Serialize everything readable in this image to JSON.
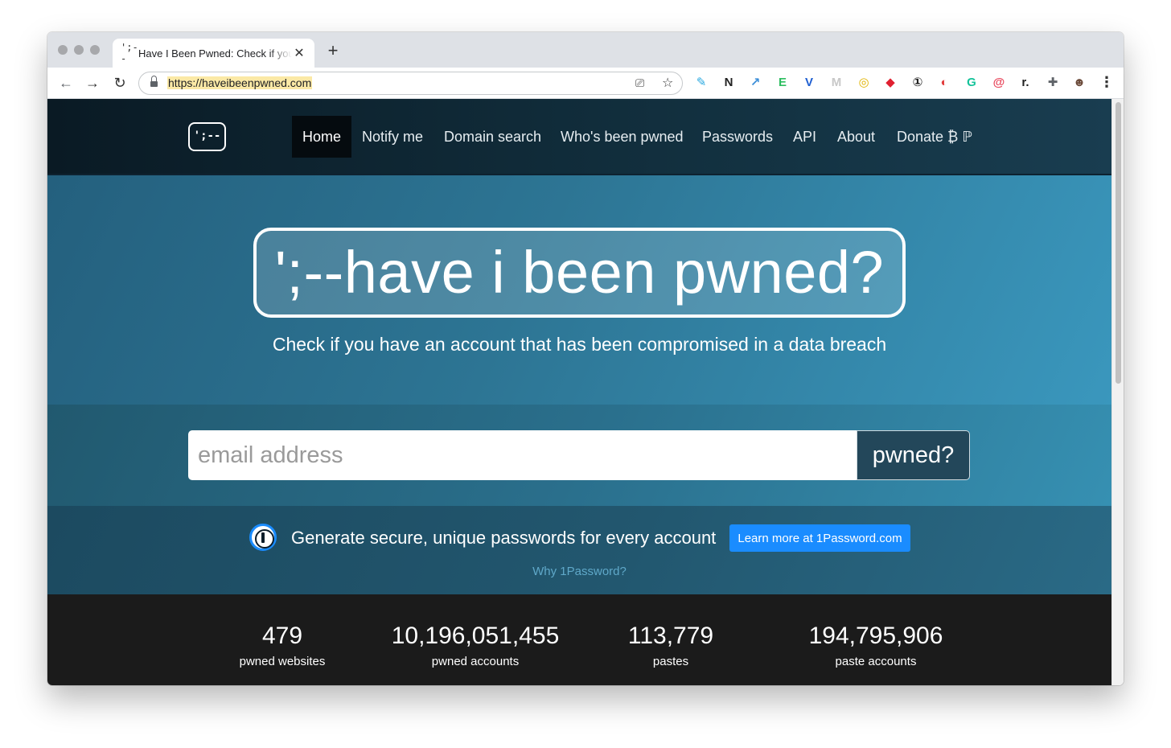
{
  "browser": {
    "tab": {
      "favicon_text": "';--",
      "title": "Have I Been Pwned: Check if you have an account that has been compromised in a data breach",
      "close_glyph": "✕"
    },
    "new_tab_glyph": "+",
    "nav": {
      "back": "←",
      "forward": "→",
      "reload": "↻"
    },
    "url": "https://haveibeenpwned.com",
    "omnibox_icons": {
      "cast": "⎚",
      "bookmark": "☆"
    },
    "extensions": [
      {
        "name": "pencil-extension-icon",
        "glyph": "✎",
        "color": "#29a8e0"
      },
      {
        "name": "notion-icon",
        "glyph": "N",
        "color": "#222222"
      },
      {
        "name": "share-extension-icon",
        "glyph": "↗",
        "color": "#3b8ed8"
      },
      {
        "name": "evernote-icon",
        "glyph": "E",
        "color": "#2dbe60"
      },
      {
        "name": "v-extension-icon",
        "glyph": "V",
        "color": "#1f5fd1"
      },
      {
        "name": "m-extension-icon",
        "glyph": "M",
        "color": "#c8c8c8"
      },
      {
        "name": "coin-extension-icon",
        "glyph": "◎",
        "color": "#e0b300"
      },
      {
        "name": "diamond-extension-icon",
        "glyph": "◆",
        "color": "#e02030"
      },
      {
        "name": "onepassword-extension-icon",
        "glyph": "①",
        "color": "#222222"
      },
      {
        "name": "ring-extension-icon",
        "glyph": "◐",
        "color": "#e23c3c"
      },
      {
        "name": "grammarly-icon",
        "glyph": "G",
        "color": "#15c39a"
      },
      {
        "name": "spiral-extension-icon",
        "glyph": "@",
        "color": "#e8455a"
      },
      {
        "name": "readwise-icon",
        "glyph": "r.",
        "color": "#222222"
      },
      {
        "name": "puzzle-extensions-icon",
        "glyph": "✚",
        "color": "#5f6368"
      },
      {
        "name": "profile-avatar",
        "glyph": "☻",
        "color": "#6b4a3a"
      }
    ],
    "menu_glyph": "⋮"
  },
  "site": {
    "logo_text": "';--",
    "nav": [
      {
        "label": "Home",
        "active": true
      },
      {
        "label": "Notify me"
      },
      {
        "label": "Domain search"
      },
      {
        "label": "Who's been pwned"
      },
      {
        "label": "Passwords"
      },
      {
        "label": "API"
      },
      {
        "label": "About"
      },
      {
        "label": "Donate ₿ ℙ"
      }
    ],
    "hero": {
      "title": "';--have i been pwned?",
      "subtitle": "Check if you have an account that has been compromised in a data breach"
    },
    "search": {
      "placeholder": "email address",
      "button": "pwned?"
    },
    "promo": {
      "text": "Generate secure, unique passwords for every account",
      "button": "Learn more at 1Password.com",
      "link": "Why 1Password?"
    },
    "stats": [
      {
        "value": "479",
        "label": "pwned websites"
      },
      {
        "value": "10,196,051,455",
        "label": "pwned accounts"
      },
      {
        "value": "113,779",
        "label": "pastes"
      },
      {
        "value": "194,795,906",
        "label": "paste accounts"
      }
    ]
  }
}
